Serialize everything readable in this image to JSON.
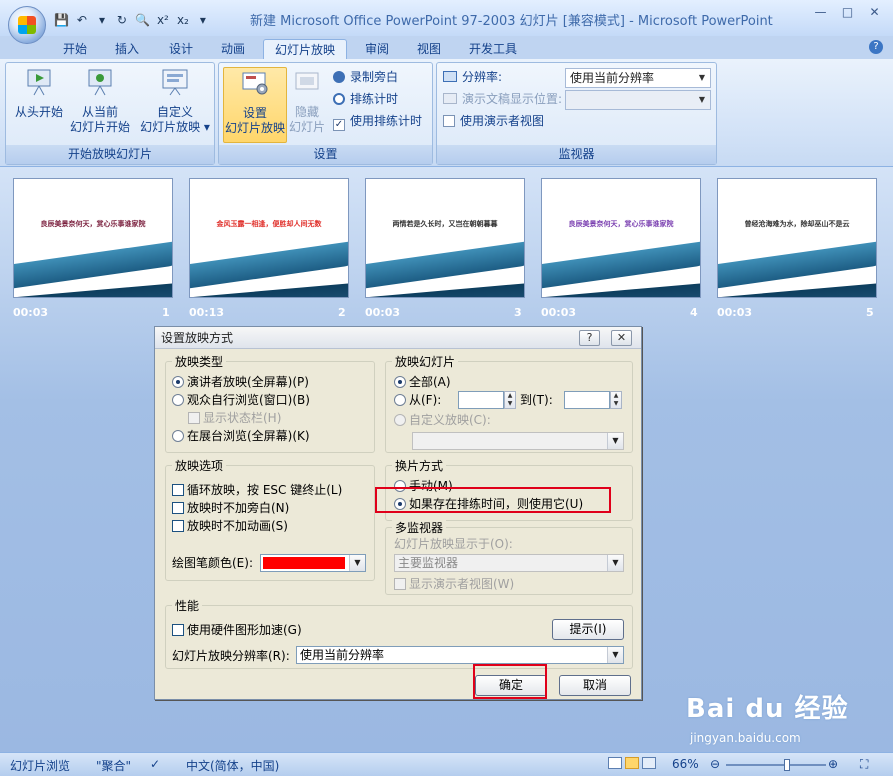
{
  "window": {
    "title": "新建 Microsoft Office PowerPoint 97-2003 幻灯片 [兼容模式] - Microsoft PowerPoint",
    "controls": [
      "—",
      "□",
      "✕"
    ]
  },
  "qat": {
    "items": [
      "💾",
      "↶",
      "▾",
      "↻",
      "🔍",
      "x²",
      "x₂",
      "▾"
    ]
  },
  "tabs": [
    {
      "label": "开始"
    },
    {
      "label": "插入"
    },
    {
      "label": "设计"
    },
    {
      "label": "动画"
    },
    {
      "label": "幻灯片放映",
      "active": true
    },
    {
      "label": "审阅"
    },
    {
      "label": "视图"
    },
    {
      "label": "开发工具"
    }
  ],
  "help": "?",
  "ribbon": {
    "group_start": {
      "caption": "开始放映幻灯片",
      "btn_from_start": "从头开始",
      "btn_from_current_1": "从当前",
      "btn_from_current_2": "幻灯片开始",
      "btn_custom_1": "自定义",
      "btn_custom_2": "幻灯片放映 ▾"
    },
    "group_setup": {
      "caption": "设置",
      "btn_setup_1": "设置",
      "btn_setup_2": "幻灯片放映",
      "btn_hide_1": "隐藏",
      "btn_hide_2": "幻灯片",
      "record": "录制旁白",
      "rehearse": "排练计时",
      "use_timings": "使用排练计时",
      "use_timings_check": "✓"
    },
    "group_monitors": {
      "caption": "监视器",
      "resolution_label": "分辨率:",
      "resolution_value": "使用当前分辨率",
      "show_on_label": "演示文稿显示位置:",
      "presenter_view": "使用演示者视图"
    }
  },
  "slides": [
    {
      "num": "1",
      "time": "00:03",
      "text": "良辰美景奈何天，赏心乐事谁家院",
      "color": "#7a1f3d"
    },
    {
      "num": "2",
      "time": "00:13",
      "text": "金风玉露一相逢，便胜却人间无数",
      "color": "#e0302b"
    },
    {
      "num": "3",
      "time": "00:03",
      "text": "两情若是久长时，又岂在朝朝暮暮",
      "color": "#333333"
    },
    {
      "num": "4",
      "time": "00:03",
      "text": "良辰美景奈何天，赏心乐事谁家院",
      "color": "#7a3fb0"
    },
    {
      "num": "5",
      "time": "00:03",
      "text": "曾经沧海难为水，除却巫山不是云",
      "color": "#333333"
    }
  ],
  "dialog": {
    "title": "设置放映方式",
    "help_btn": "?",
    "close_btn": "✕",
    "show_type": {
      "legend": "放映类型",
      "presenter": "演讲者放映(全屏幕)(P)",
      "browse_window": "观众自行浏览(窗口)(B)",
      "show_scrollbar": "显示状态栏(H)",
      "kiosk": "在展台浏览(全屏幕)(K)"
    },
    "show_slides": {
      "legend": "放映幻灯片",
      "all": "全部(A)",
      "from": "从(F):",
      "to": "到(T):",
      "custom": "自定义放映(C):"
    },
    "show_options": {
      "legend": "放映选项",
      "loop": "循环放映，按 ESC 键终止(L)",
      "no_narration": "放映时不加旁白(N)",
      "no_animation": "放映时不加动画(S)",
      "pen_color": "绘图笔颜色(E):",
      "pen_color_value": "#ff0000"
    },
    "advance": {
      "legend": "换片方式",
      "manual": "手动(M)",
      "use_timings": "如果存在排练时间，则使用它(U)"
    },
    "multi_monitor": {
      "legend": "多监视器",
      "display_on": "幻灯片放映显示于(O):",
      "display_value": "主要监视器",
      "presenter_view": "显示演示者视图(W)"
    },
    "performance": {
      "legend": "性能",
      "hw_accel": "使用硬件图形加速(G)",
      "tips": "提示(I)",
      "resolution_label": "幻灯片放映分辨率(R):",
      "resolution_value": "使用当前分辨率"
    },
    "ok": "确定",
    "cancel": "取消"
  },
  "statusbar": {
    "view": "幻灯片浏览",
    "theme": "\"聚合\"",
    "lang": "中文(简体，中国)",
    "zoom": "66%"
  },
  "watermark": {
    "brand": "Bai du 经验",
    "url": "jingyan.baidu.com"
  }
}
